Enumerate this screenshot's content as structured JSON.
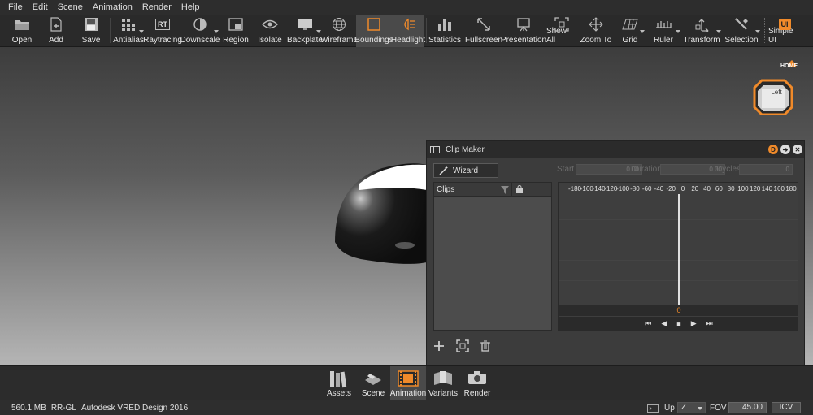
{
  "menu": [
    "File",
    "Edit",
    "Scene",
    "Animation",
    "Render",
    "Help"
  ],
  "toolbar": {
    "open": "Open",
    "add": "Add",
    "save": "Save",
    "antialias": "Antialias",
    "raytracing": "Raytracing",
    "raytracing_badge": "RT",
    "downscale": "Downscale",
    "region": "Region",
    "isolate": "Isolate",
    "backplate": "Backplate",
    "wireframe": "Wireframe",
    "boundings": "Boundings",
    "headlight": "Headlight",
    "statistics": "Statistics",
    "fullscreen": "Fullscreen",
    "presentation": "Presentation",
    "show_all": "Show All",
    "zoom_to": "Zoom To",
    "grid": "Grid",
    "ruler": "Ruler",
    "transform": "Transform",
    "selection": "Selection",
    "simple_ui": "Simple UI",
    "simple_ui_badge": "UI"
  },
  "navcube": {
    "home_label": "HOME",
    "face_label": "Left"
  },
  "clip_maker": {
    "title": "Clip Maker",
    "wizard_label": "Wizard",
    "start_label": "Start",
    "start_value": "0.00",
    "duration_label": "Duration",
    "duration_value": "0.00",
    "cycles_label": "Cycles",
    "cycles_value": "0",
    "clips_header": "Clips",
    "ruler_ticks": [
      "-180",
      "-160",
      "-140",
      "-120",
      "-100",
      "-80",
      "-60",
      "-40",
      "-20",
      "0",
      "20",
      "40",
      "60",
      "80",
      "100",
      "120",
      "140",
      "160",
      "180"
    ],
    "current_time": "0"
  },
  "modules": {
    "assets": "Assets",
    "scene": "Scene",
    "animation": "Animation",
    "variants": "Variants",
    "render": "Render"
  },
  "status": {
    "memory": "560.1 MB",
    "renderer": "RR-GL",
    "product": "Autodesk VRED Design 2016",
    "up_label": "Up",
    "up_value": "Z",
    "fov_label": "FOV",
    "fov_value": "45.00",
    "icv": "ICV"
  },
  "colors": {
    "accent": "#f08a2a",
    "toolbar_bg": "#2a2a2a",
    "panel_bg": "#3c3c3c"
  }
}
